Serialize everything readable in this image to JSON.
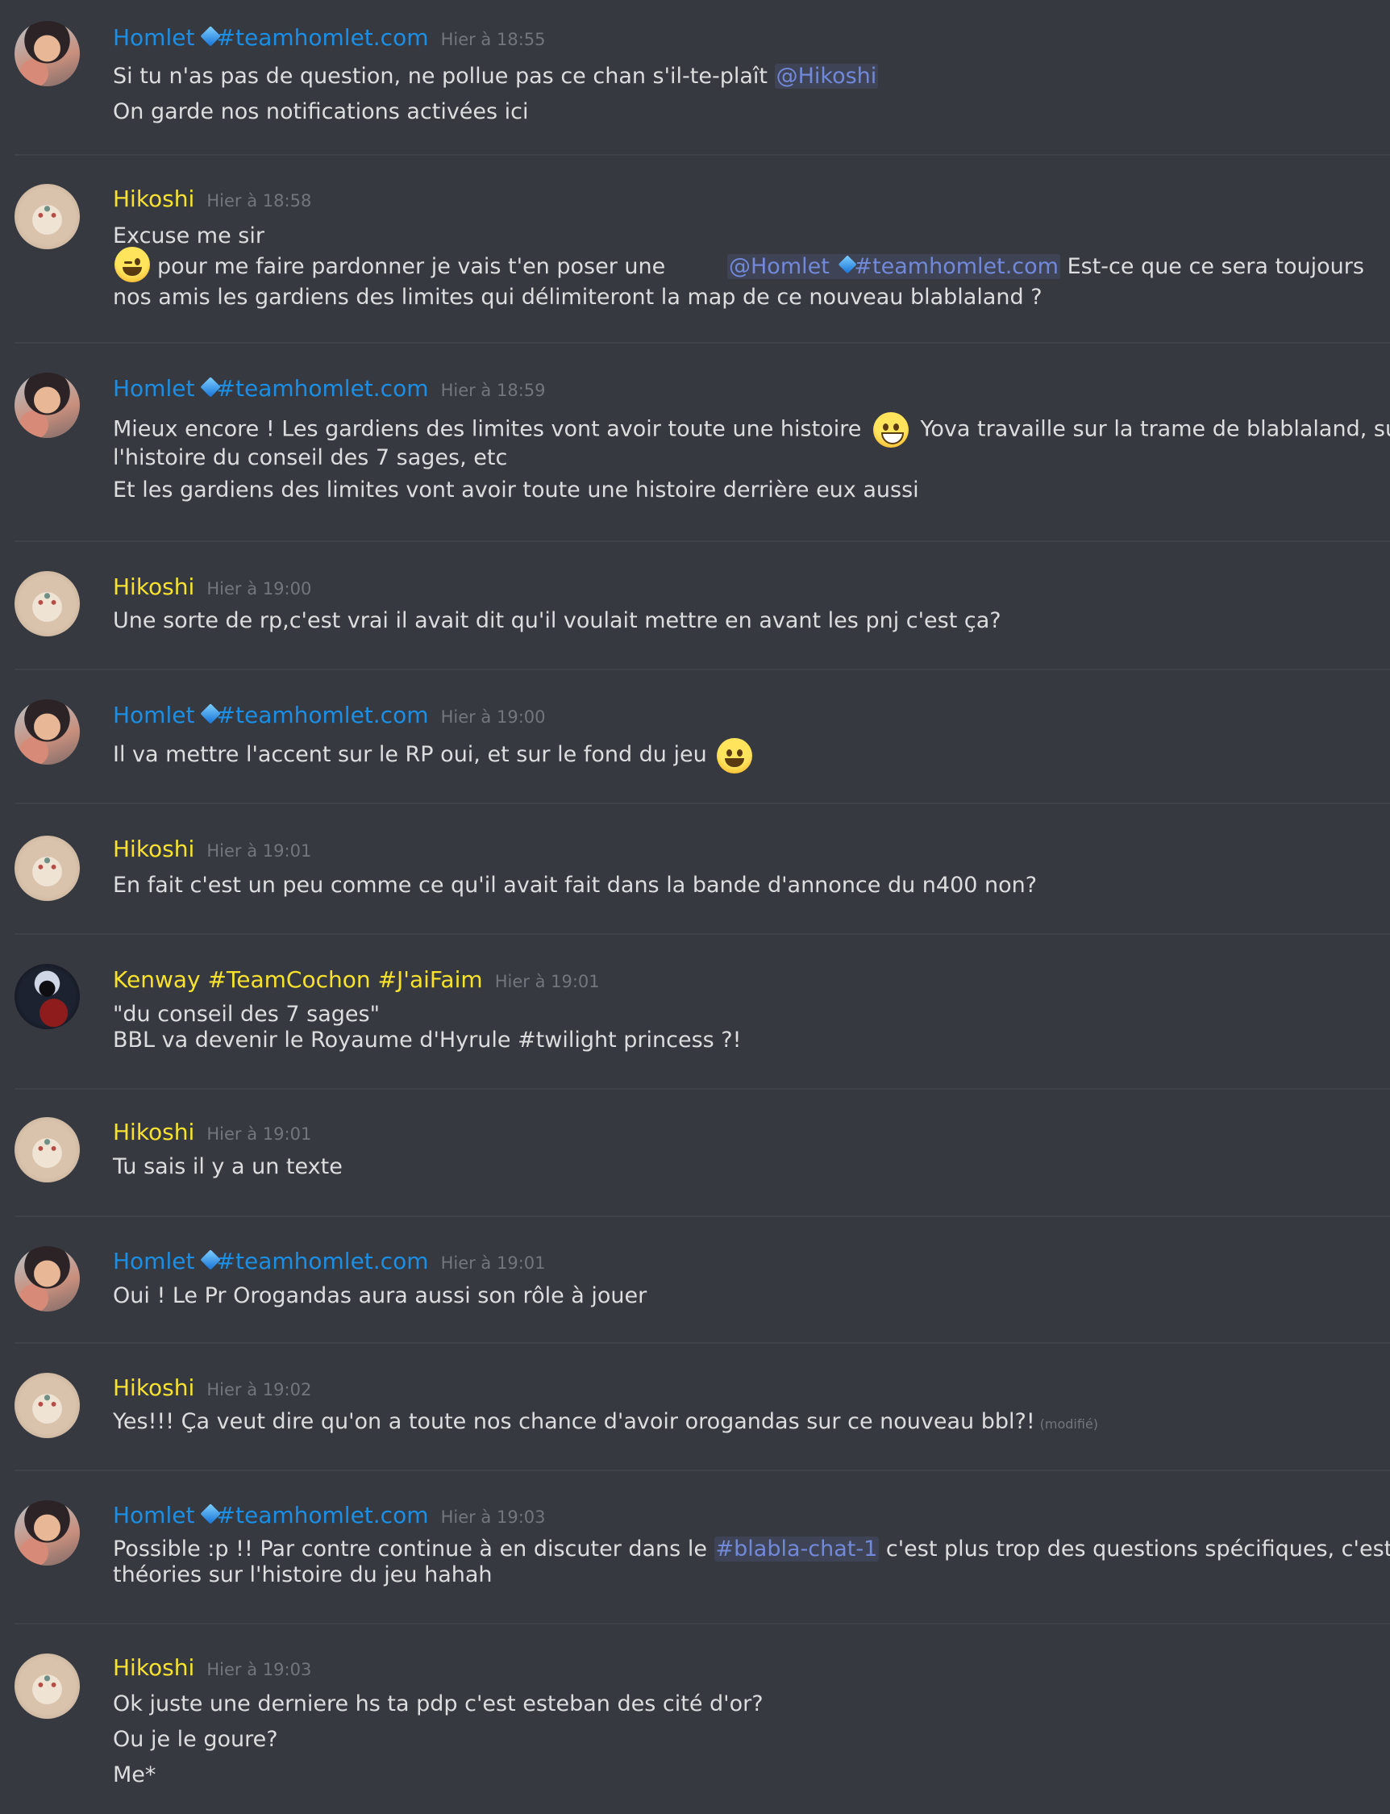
{
  "messages": [
    {
      "author": "Homlet",
      "role": "homlet",
      "tag": "#teamhomlet.com",
      "time": "Hier à 18:55",
      "segments": [
        {
          "text": "Si tu n'as pas de question, ne pollue pas ce chan s'il-te-plaît "
        },
        {
          "mention": "@Hikoshi"
        }
      ],
      "extra_lines": [
        "On garde nos notifications activées ici"
      ]
    },
    {
      "author": "Hikoshi",
      "role": "hikoshi",
      "time": "Hier à 18:58",
      "line1": "Excuse me sir",
      "line2_prefix": "pour me faire pardonner je vais t'en poser une",
      "line2_mention": "@Homlet",
      "line2_mention_tag": "#teamhomlet.com",
      "line2_suffix": "Est-ce que ce sera toujours",
      "line3": "nos amis les gardiens  des limites qui délimiteront la map de ce nouveau blablaland ?"
    },
    {
      "author": "Homlet",
      "role": "homlet",
      "tag": "#teamhomlet.com",
      "time": "Hier à 18:59",
      "line1_prefix": "Mieux encore ! Les gardiens des limites vont avoir toute une histoire",
      "line1_suffix": "Yova travaille sur la trame de blablaland, sur",
      "line2": "l'histoire du conseil des 7 sages, etc",
      "line3": "Et les gardiens des limites vont avoir toute une histoire derrière eux aussi"
    },
    {
      "author": "Hikoshi",
      "role": "hikoshi",
      "time": "Hier à 19:00",
      "text": "Une sorte de rp,c'est vrai il avait dit qu'il voulait mettre en avant les pnj c'est ça?"
    },
    {
      "author": "Homlet",
      "role": "homlet",
      "tag": "#teamhomlet.com",
      "time": "Hier à 19:00",
      "text": "Il va mettre l'accent sur le RP oui, et sur le fond du jeu"
    },
    {
      "author": "Hikoshi",
      "role": "hikoshi",
      "time": "Hier à 19:01",
      "text": "En fait c'est un peu comme ce qu'il avait fait dans la bande d'annonce du n400 non?"
    },
    {
      "author": "Kenway #TeamCochon #J'aiFaim",
      "role": "kenway",
      "time": "Hier à 19:01",
      "line1": "\"du conseil des 7 sages\"",
      "line2": "BBL va devenir le Royaume d'Hyrule #twilight princess ?!"
    },
    {
      "author": "Hikoshi",
      "role": "hikoshi",
      "time": "Hier à 19:01",
      "text": "Tu sais il y a un texte"
    },
    {
      "author": "Homlet",
      "role": "homlet",
      "tag": "#teamhomlet.com",
      "time": "Hier à 19:01",
      "text": "Oui ! Le Pr Orogandas aura aussi son rôle à jouer"
    },
    {
      "author": "Hikoshi",
      "role": "hikoshi",
      "time": "Hier à 19:02",
      "text": "Yes!!! Ça veut dire qu'on a toute nos chance d'avoir orogandas sur ce nouveau bbl?!",
      "edited": "(modifié)"
    },
    {
      "author": "Homlet",
      "role": "homlet",
      "tag": "#teamhomlet.com",
      "time": "Hier à 19:03",
      "line1_prefix": "Possible :p !! Par contre continue à en discuter dans le",
      "channel": "#blabla-chat-1",
      "line1_suffix": "c'est plus trop des questions spécifiques, c'est des",
      "line2": "théories sur l'histoire du jeu hahah"
    },
    {
      "author": "Hikoshi",
      "role": "hikoshi",
      "time": "Hier à 19:03",
      "line1": "Ok juste une derniere hs ta pdp c'est esteban des cité d'or?",
      "line2": "Ou je le goure?",
      "line3": "Me*"
    }
  ],
  "colors": {
    "background": "#36393f",
    "homlet_name": "#1b8fe6",
    "hikoshi_name": "#f8e22d",
    "mention": "#7289da",
    "timestamp": "#72767d"
  },
  "icons": {
    "role_badge": "blue-diamond-icon",
    "emoji_1": "winking-face-emoji",
    "emoji_2": "grinning-face-emoji",
    "emoji_3": "smiling-face-emoji"
  }
}
